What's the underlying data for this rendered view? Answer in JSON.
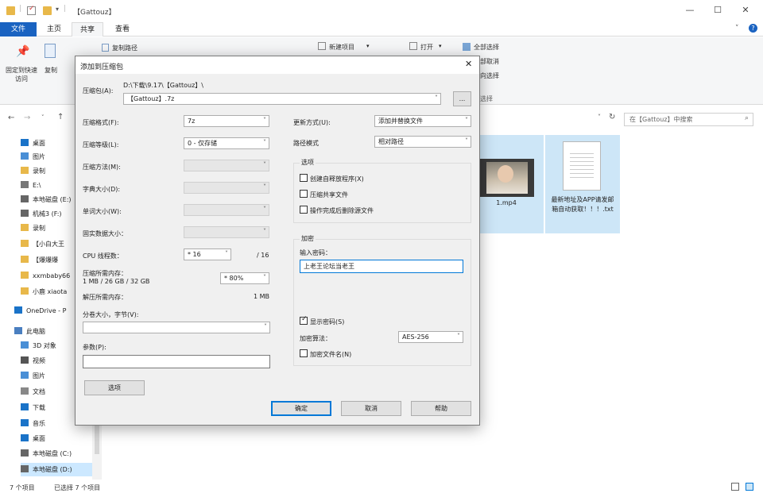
{
  "explorer": {
    "title": "【Gattouz】",
    "tabs": [
      "文件",
      "主页",
      "共享",
      "查看"
    ],
    "ribbon": {
      "pin_label": "固定到快速访问",
      "copy_label": "复制",
      "copy_path_label": "复制路径",
      "new_item_label": "新建项目",
      "open_label": "打开",
      "select_all_label": "全部选择",
      "select_none_label": "全部取消",
      "invert_label": "反向选择",
      "select_group": "选择"
    },
    "search_placeholder": "在【Gattouz】中搜索",
    "nav_items": [
      "桌面",
      "图片",
      "录制",
      "E:\\",
      "本地磁盘 (E:)",
      "机械3 (F:)",
      "录制",
      "【小白大王",
      "【爆爆爆",
      "xxmbaby66",
      "小鹿 xiaota",
      "OneDrive - P",
      "此电脑",
      "3D 对象",
      "视频",
      "图片",
      "文档",
      "下载",
      "音乐",
      "桌面",
      "本地磁盘 (C:)",
      "本地磁盘 (D:)"
    ],
    "files": [
      {
        "name": "1.mp4"
      },
      {
        "name": "最新地址及APP请发邮箱自动获取！！！.txt"
      }
    ],
    "status_left": "7 个项目",
    "status_selected": "已选择 7 个项目"
  },
  "dialog": {
    "title": "添加到压缩包",
    "archive_label": "压缩包(A):",
    "archive_path": "D:\\下载\\9.17\\【Gattouz】\\",
    "archive_name": "【Gattouz】.7z",
    "browse_label": "...",
    "format_label": "压缩格式(F):",
    "format_value": "7z",
    "level_label": "压缩等级(L):",
    "level_value": "0 - 仅存储",
    "method_label": "压缩方法(M):",
    "dict_label": "字典大小(D):",
    "word_label": "单词大小(W):",
    "solid_label": "固实数据大小：",
    "cpu_label": "CPU 线程数：",
    "cpu_value": "16",
    "cpu_total": "/ 16",
    "mem_comp_label": "压缩所需内存：",
    "mem_comp_detail": "1 MB / 26 GB / 32 GB",
    "mem_percent": "80%",
    "mem_decomp_label": "解压所需内存：",
    "mem_decomp_value": "1 MB",
    "split_label": "分卷大小，字节(V):",
    "params_label": "参数(P):",
    "options_button": "选项",
    "update_label": "更新方式(U):",
    "update_value": "添加并替换文件",
    "path_mode_label": "路径模式",
    "path_mode_value": "相对路径",
    "options_group": "选项",
    "opt_sfx": "创建自释放程序(X)",
    "opt_shared": "压缩共享文件",
    "opt_delete": "操作完成后删除源文件",
    "encrypt_group": "加密",
    "password_label": "输入密码：",
    "password_value": "上老王论坛当老王",
    "show_password": "显示密码(S)",
    "encrypt_method_label": "加密算法：",
    "encrypt_method_value": "AES-256",
    "encrypt_names": "加密文件名(N)",
    "ok_button": "确定",
    "cancel_button": "取消",
    "help_button": "帮助"
  }
}
